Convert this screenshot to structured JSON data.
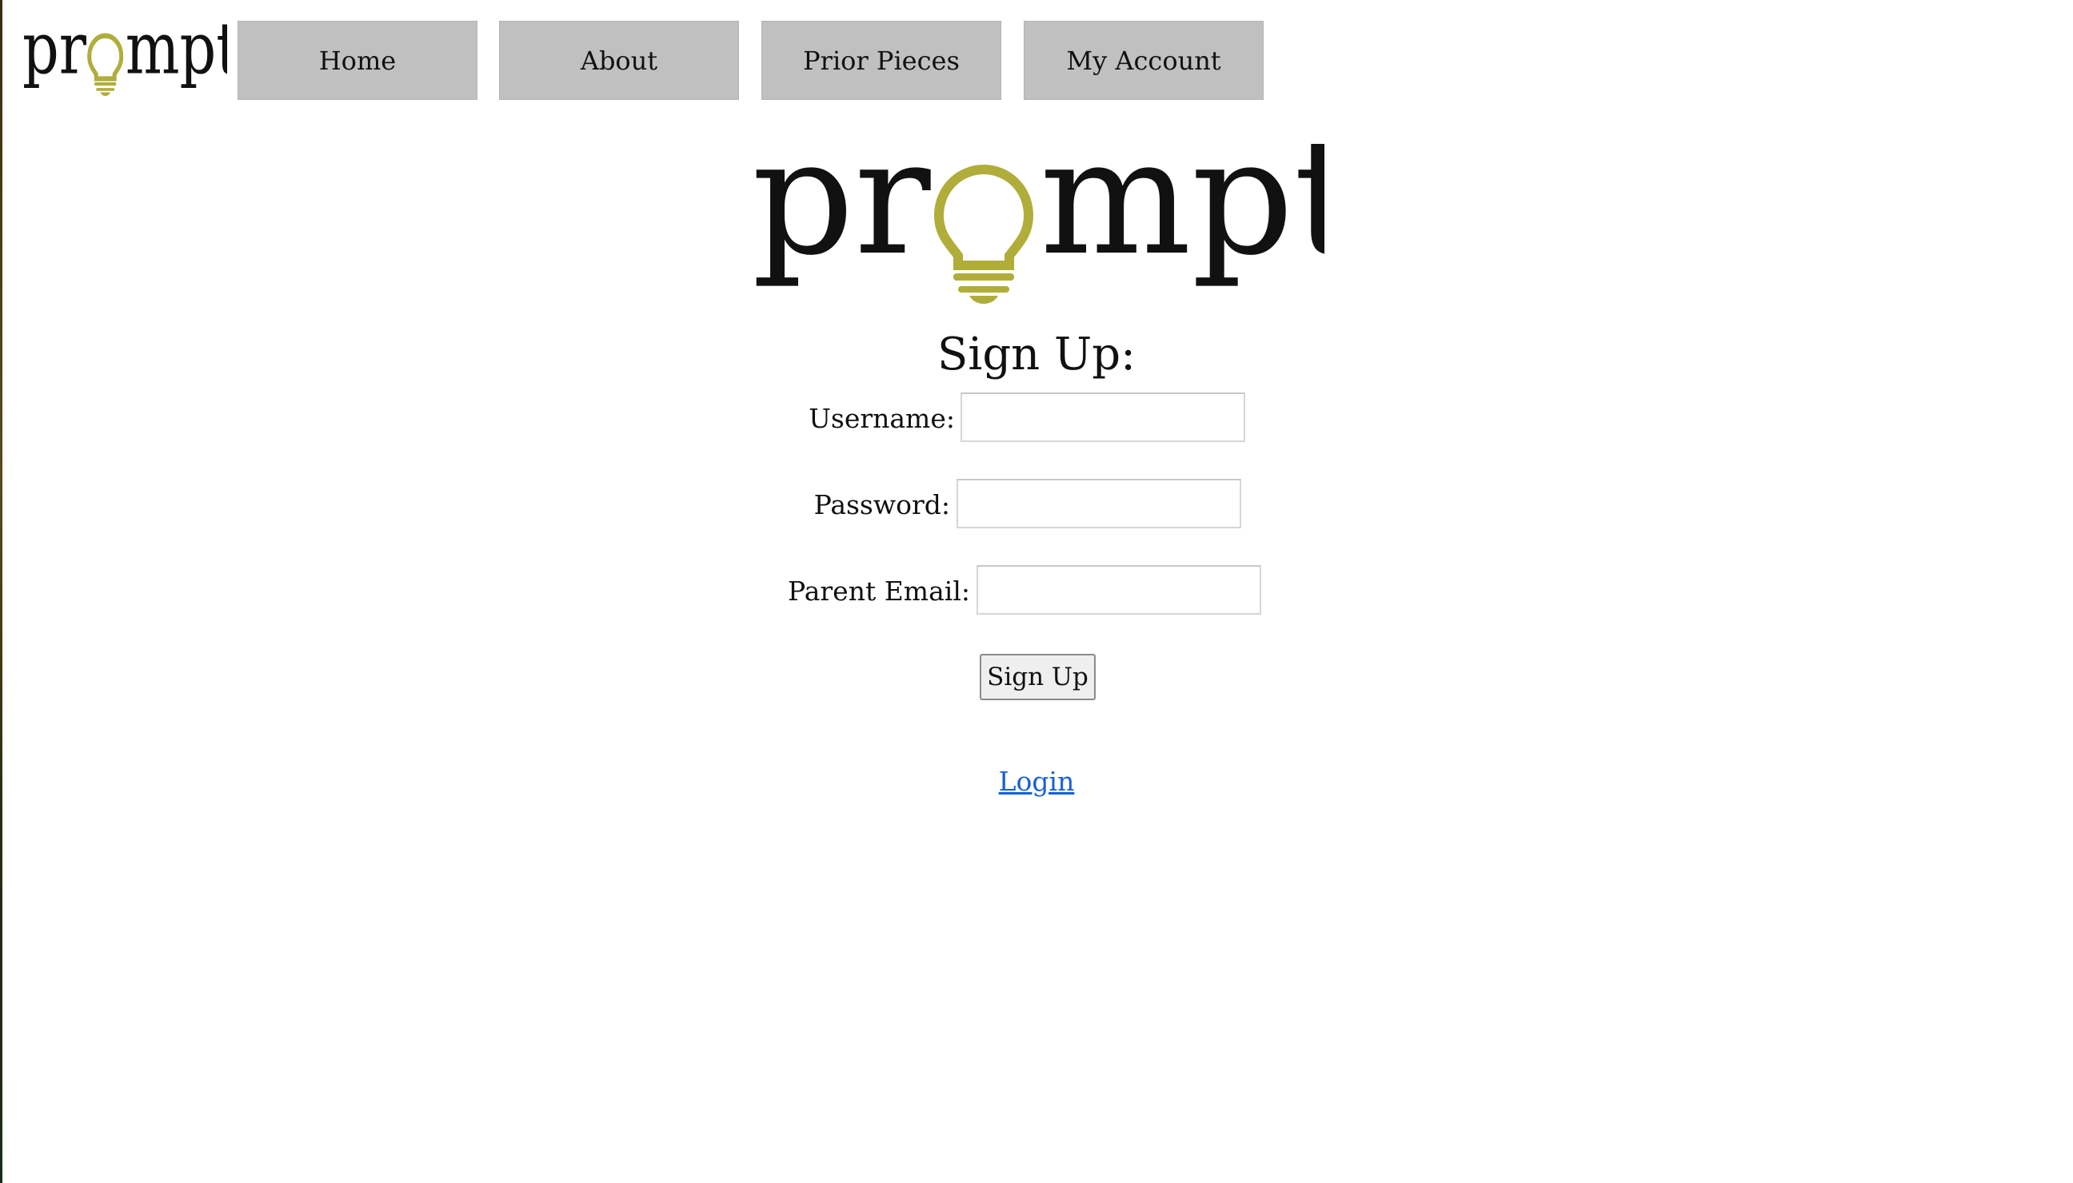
{
  "brand": {
    "name": "promptl",
    "accent_color": "#b0ad3a",
    "logo_icon": "lightbulb-icon"
  },
  "nav": {
    "items": [
      {
        "label": "Home"
      },
      {
        "label": "About"
      },
      {
        "label": "Prior Pieces"
      },
      {
        "label": "My Account"
      }
    ]
  },
  "form": {
    "title": "Sign Up:",
    "fields": [
      {
        "label": "Username:",
        "value": "",
        "placeholder": ""
      },
      {
        "label": "Password:",
        "value": "",
        "placeholder": ""
      },
      {
        "label": "Parent Email:",
        "value": "",
        "placeholder": ""
      }
    ],
    "submit_label": "Sign Up"
  },
  "login_link": {
    "label": "Login"
  }
}
